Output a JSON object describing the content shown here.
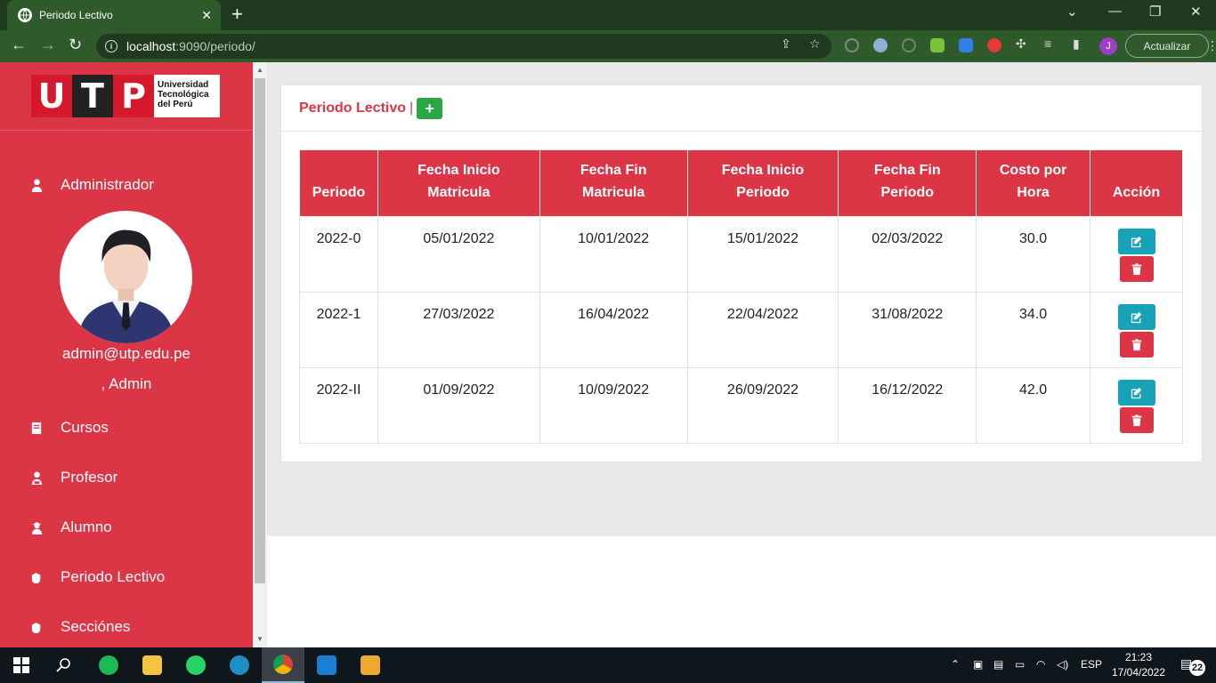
{
  "browser": {
    "tab_title": "Periodo Lectivo",
    "url_host": "localhost",
    "url_rest": ":9090/periodo/",
    "update_label": "Actualizar",
    "profile_initial": "J"
  },
  "sidebar": {
    "logo": {
      "letters": [
        "U",
        "T",
        "P"
      ],
      "name_lines": [
        "Universidad",
        "Tecnológica",
        "del Perú"
      ]
    },
    "admin_label": "Administrador",
    "user_email": "admin@utp.edu.pe",
    "user_name": ", Admin",
    "items": [
      {
        "label": "Cursos",
        "icon": "book-icon"
      },
      {
        "label": "Profesor",
        "icon": "teacher-icon"
      },
      {
        "label": "Alumno",
        "icon": "student-icon"
      },
      {
        "label": "Periodo Lectivo",
        "icon": "hand-icon"
      },
      {
        "label": "Secciónes",
        "icon": "hand-icon"
      }
    ]
  },
  "main": {
    "title": "Periodo Lectivo",
    "separator": "|",
    "add_label": "+",
    "table": {
      "headers": [
        [
          "Periodo"
        ],
        [
          "Fecha Inicio",
          "Matricula"
        ],
        [
          "Fecha Fin",
          "Matricula"
        ],
        [
          "Fecha Inicio",
          "Periodo"
        ],
        [
          "Fecha Fin",
          "Periodo"
        ],
        [
          "Costo por",
          "Hora"
        ],
        [
          "Acción"
        ]
      ],
      "rows": [
        [
          "2022-0",
          "05/01/2022",
          "10/01/2022",
          "15/01/2022",
          "02/03/2022",
          "30.0"
        ],
        [
          "2022-1",
          "27/03/2022",
          "16/04/2022",
          "22/04/2022",
          "31/08/2022",
          "34.0"
        ],
        [
          "2022-II",
          "01/09/2022",
          "10/09/2022",
          "26/09/2022",
          "16/12/2022",
          "42.0"
        ]
      ]
    }
  },
  "taskbar": {
    "language": "ESP",
    "time": "21:23",
    "date": "17/04/2022",
    "notifications": "22",
    "apps": [
      "windows-start-icon",
      "search-icon",
      "spotify-icon",
      "file-explorer-icon",
      "whatsapp-icon",
      "edge-icon",
      "chrome-icon",
      "vscode-icon",
      "app-icon"
    ]
  },
  "colors": {
    "primary_red": "#dc3545",
    "add_green": "#28a745",
    "edit_teal": "#17a2b8",
    "chrome_green": "#2f5a2b"
  }
}
